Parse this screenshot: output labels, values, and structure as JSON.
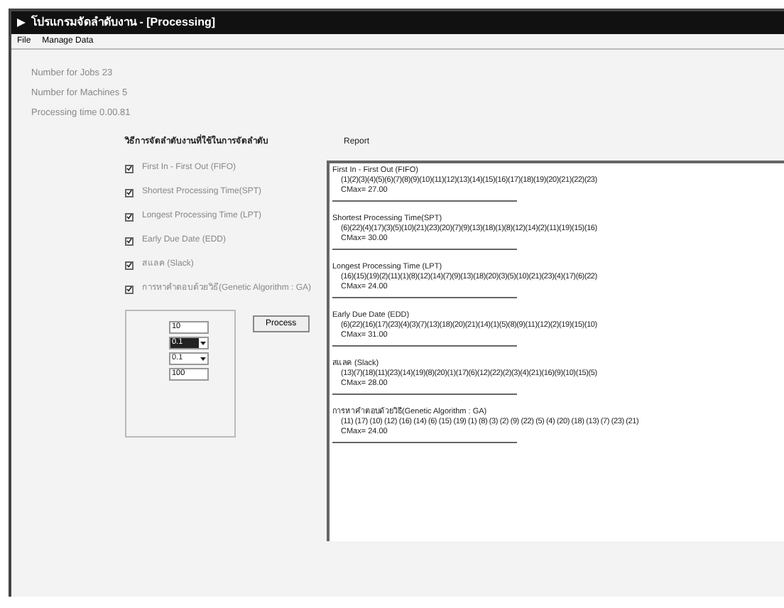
{
  "window": {
    "title": "โปรแกรมจัดลำดับงาน - [Processing]"
  },
  "menu": [
    "File",
    "Manage Data"
  ],
  "info": [
    "Number for Jobs  23",
    "Number for Machines  5",
    "Processing time  0.00.81"
  ],
  "methods_heading": "วิธีการจัดลำดับงานที่ใช้ในการจัดลำดับ",
  "methods": [
    {
      "label": "First  In - First Out (FIFO)",
      "checked": true
    },
    {
      "label": "Shortest  Processing  Time(SPT)",
      "checked": true
    },
    {
      "label": "Longest  Processing  Time (LPT)",
      "checked": true
    },
    {
      "label": "Early Due  Date (EDD)",
      "checked": true
    },
    {
      "label": "สแลค (Slack)",
      "checked": true
    },
    {
      "label": "การหาคำตอบด้วยวิธี(Genetic  Algorithm  :  GA)",
      "checked": true
    }
  ],
  "ga_params": [
    {
      "kind": "text",
      "value": "10"
    },
    {
      "kind": "dropdown",
      "value": "0.1",
      "selected": true
    },
    {
      "kind": "dropdown",
      "value": "0.1",
      "selected": false
    },
    {
      "kind": "text",
      "value": "100"
    }
  ],
  "process_button": "Process",
  "report": {
    "label": "Report",
    "sections": [
      {
        "title": "First In - First Out (FIFO)",
        "sequence": "(1)(2)(3)(4)(5)(6)(7)(8)(9)(10)(11)(12)(13)(14)(15)(16)(17)(18)(19)(20)(21)(22)(23)",
        "cmax": "CMax= 27.00"
      },
      {
        "title": "Shortest  Processing  Time(SPT)",
        "sequence": "(6)(22)(4)(17)(3)(5)(10)(21)(23)(20)(7)(9)(13)(18)(1)(8)(12)(14)(2)(11)(19)(15)(16)",
        "cmax": "CMax= 30.00"
      },
      {
        "title": "Longest  Processing  Time (LPT)",
        "sequence": "(16)(15)(19)(2)(11)(1)(8)(12)(14)(7)(9)(13)(18)(20)(3)(5)(10)(21)(23)(4)(17)(6)(22)",
        "cmax": "CMax= 24.00"
      },
      {
        "title": "Early Due  Date (EDD)",
        "sequence": "(6)(22)(16)(17)(23)(4)(3)(7)(13)(18)(20)(21)(14)(1)(5)(8)(9)(11)(12)(2)(19)(15)(10)",
        "cmax": "CMax= 31.00"
      },
      {
        "title": "สแลค (Slack)",
        "sequence": "(13)(7)(18)(11)(23)(14)(19)(8)(20)(1)(17)(6)(12)(22)(2)(3)(4)(21)(16)(9)(10)(15)(5)",
        "cmax": "CMax= 28.00"
      },
      {
        "title": "การหาคำตอบด้วยวิธี(Genetic  Algorithm  :  GA)",
        "sequence": "(11) (17) (10) (12) (16) (14) (6) (15) (19) (1) (8) (3) (2) (9) (22) (5) (4) (20) (18) (13) (7) (23) (21)",
        "cmax": "CMax= 24.00"
      }
    ]
  }
}
